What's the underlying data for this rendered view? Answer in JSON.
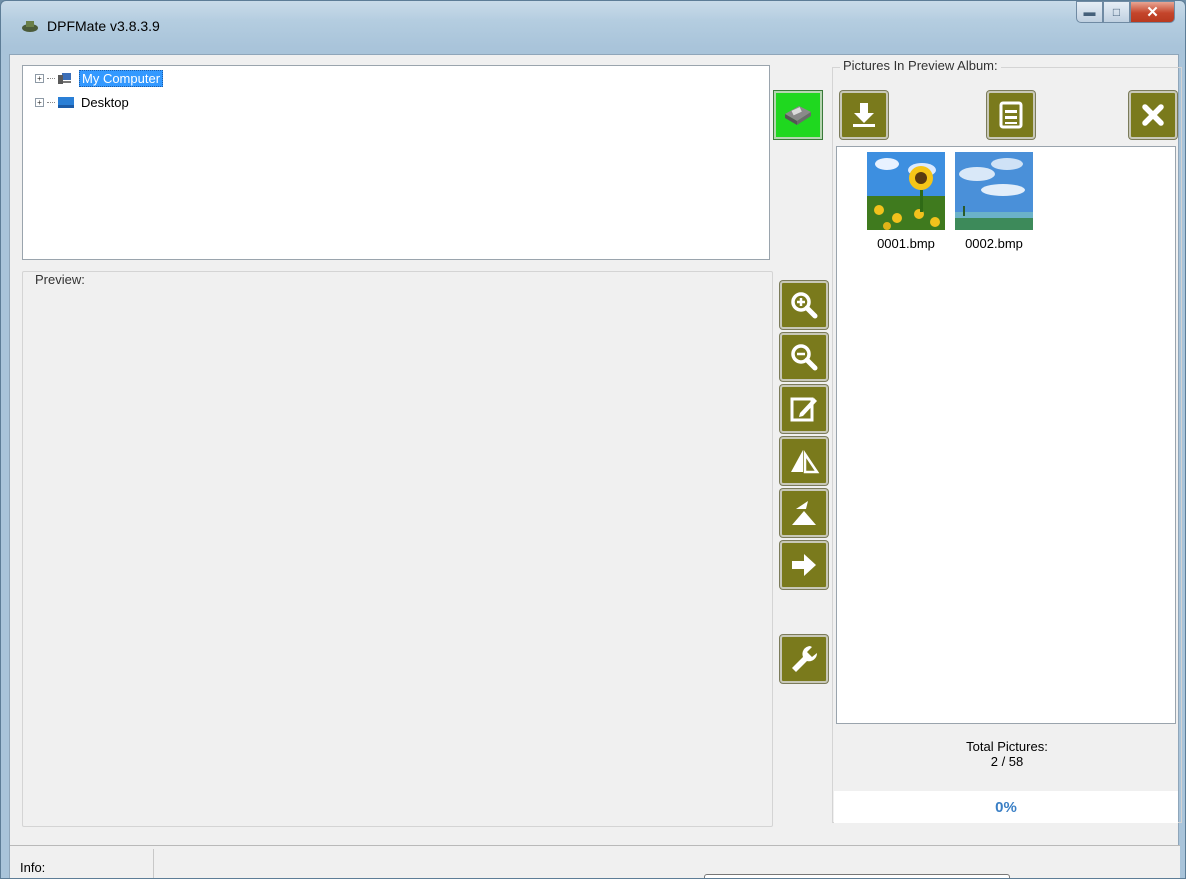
{
  "window": {
    "title": "DPFMate v3.8.3.9"
  },
  "tree": {
    "items": [
      {
        "label": "My Computer",
        "selected": true
      },
      {
        "label": "Desktop",
        "selected": false
      }
    ]
  },
  "preview": {
    "label": "Preview:"
  },
  "album": {
    "label": "Pictures In Preview Album:",
    "pictures": [
      {
        "name": "0001.bmp"
      },
      {
        "name": "0002.bmp"
      }
    ],
    "total_label": "Total Pictures:",
    "total_value": "2 / 58",
    "progress_text": "0%"
  },
  "status": {
    "info_label": "Info:"
  },
  "icons": {
    "add": "download-arrow-icon",
    "save": "save-list-icon",
    "remove": "close-x-icon",
    "transfer": "device-transfer-icon",
    "zoom_in": "zoom-in-icon",
    "zoom_out": "zoom-out-icon",
    "edit": "edit-icon",
    "flip_horizontal": "flip-horizontal-icon",
    "flip_vertical": "flip-vertical-icon",
    "next": "arrow-right-icon",
    "settings": "wrench-icon"
  },
  "colors": {
    "button_olive": "#7a7a1c",
    "transfer_green": "#1fd81f",
    "selection": "#3399ff",
    "progress_text": "#3a7fc5"
  }
}
